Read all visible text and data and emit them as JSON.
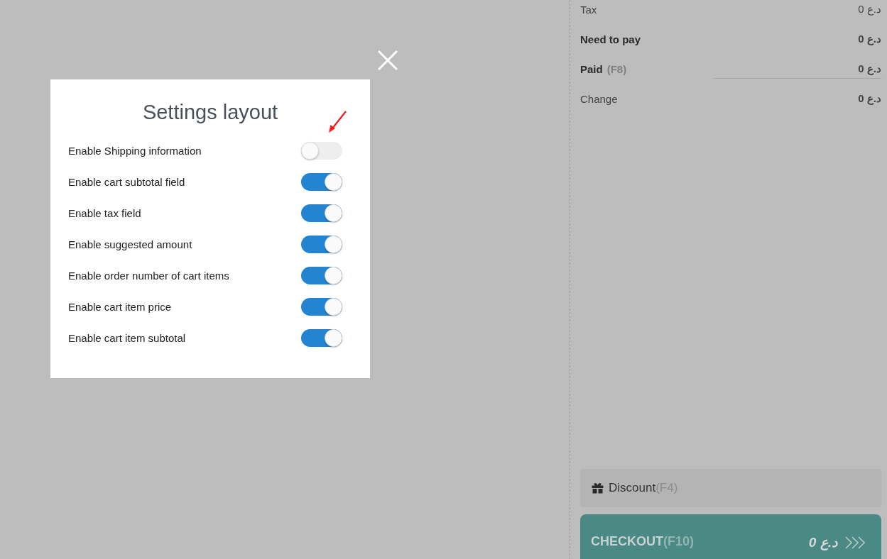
{
  "modal": {
    "title": "Settings layout"
  },
  "settings": [
    {
      "label": "Enable Shipping information",
      "on": false
    },
    {
      "label": "Enable cart subtotal field",
      "on": true
    },
    {
      "label": "Enable tax field",
      "on": true
    },
    {
      "label": "Enable suggested amount",
      "on": true
    },
    {
      "label": "Enable order number of cart items",
      "on": true
    },
    {
      "label": "Enable cart item price",
      "on": true
    },
    {
      "label": "Enable cart item subtotal",
      "on": true
    }
  ],
  "summary": [
    {
      "kind": "plain",
      "label": "Tax",
      "value": "0 د.ع"
    },
    {
      "kind": "total",
      "label": "Need to pay",
      "value": "0 د.ع"
    },
    {
      "kind": "input",
      "label": "Paid",
      "hint": "(F8)",
      "value": "0 د.ع"
    },
    {
      "kind": "result",
      "label": "Change",
      "value": "0 د.ع"
    }
  ],
  "discount": {
    "label": "Discount",
    "shortcut": "(F4)"
  },
  "checkout": {
    "label": "CHECKOUT",
    "shortcut": "(F10)",
    "amount": "0 د.ع"
  }
}
